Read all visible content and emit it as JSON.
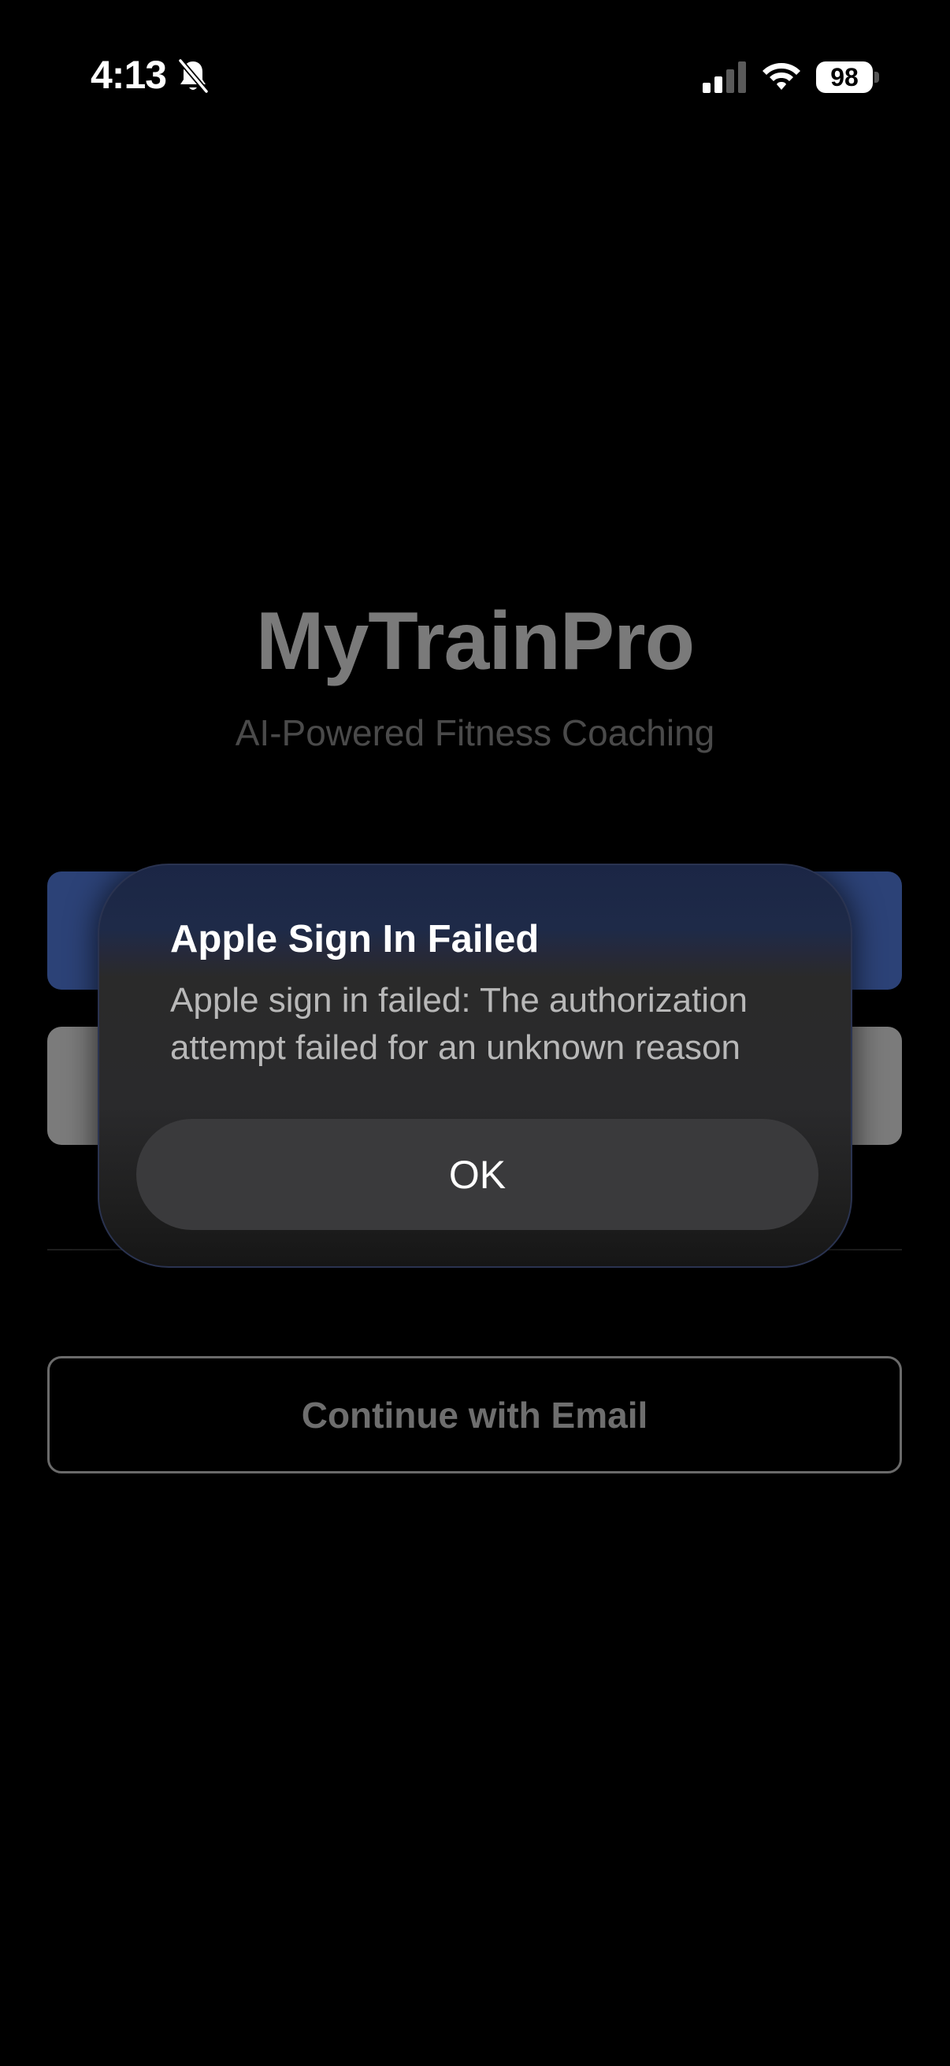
{
  "status_bar": {
    "time": "4:13",
    "battery_level": "98",
    "icons": [
      "bell-slash-icon",
      "cellular-signal-icon",
      "wifi-icon",
      "battery-icon"
    ]
  },
  "app": {
    "title": "MyTrainPro",
    "subtitle": "AI-Powered Fitness Coaching"
  },
  "buttons": {
    "apple_color": "#2c4277",
    "google_color": "#7b7b7b",
    "email_label": "Continue with Email"
  },
  "alert": {
    "title": "Apple Sign In Failed",
    "message": "Apple sign in failed: The authorization attempt failed for an unknown reason",
    "ok_label": "OK"
  }
}
